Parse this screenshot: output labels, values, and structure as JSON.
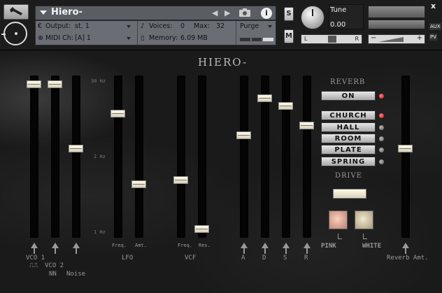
{
  "header": {
    "title": "Hiero-",
    "output_label": "Output:",
    "output_value": "st. 1",
    "voices_label": "Voices:",
    "voices_value": "0",
    "max_label": "Max:",
    "max_value": "32",
    "purge_label": "Purge",
    "midi_label": "MIDI Ch:",
    "midi_value": "[A]  1",
    "memory_label": "Memory:",
    "memory_value": "6.09 MB",
    "s_label": "S",
    "m_label": "M",
    "tune_label": "Tune",
    "tune_value": "0.00",
    "pan_left": "L",
    "pan_right": "R",
    "vol_minus": "−",
    "vol_plus": "+",
    "aux_label": "AUX",
    "pv_label": "PV",
    "close_label": "x",
    "info_label": "i",
    "prev_arrow": "◀",
    "next_arrow": "▶"
  },
  "panel": {
    "title": "HIERO-",
    "scale_top": "30 Hz",
    "scale_mid": "2 Hz",
    "scale_bot": "1 Hz",
    "labels": {
      "vco1": "VCO 1",
      "vco2": "VCO 2",
      "noise": "Noise",
      "lfo": "LFO",
      "lfo_freq": "Freq.",
      "lfo_amt": "Amt.",
      "vcf": "VCF",
      "vcf_freq": "Freq.",
      "vcf_res": "Res.",
      "a": "A",
      "d": "D",
      "s": "S",
      "r": "R",
      "reverb_amt": "Reverb Amt.",
      "pink": "PINK",
      "white": "WHITE",
      "square_wave": "⎍⎍",
      "saw_wave": "NN"
    },
    "reverb": {
      "title": "REVERB",
      "on_label": "ON",
      "types": [
        "CHURCH",
        "HALL",
        "ROOM",
        "PLATE",
        "SPRING"
      ],
      "selected": "CHURCH"
    },
    "drive": {
      "title": "DRIVE"
    },
    "sliders": {
      "vco1": 0.97,
      "vco2": 0.97,
      "noise": 0.55,
      "lfo_freq": 0.78,
      "lfo_amt": 0.32,
      "vcf_freq": 0.35,
      "vcf_res": 0.03,
      "a": 0.64,
      "d": 0.88,
      "s": 0.83,
      "r": 0.7,
      "reverb_amt": 0.55
    }
  }
}
